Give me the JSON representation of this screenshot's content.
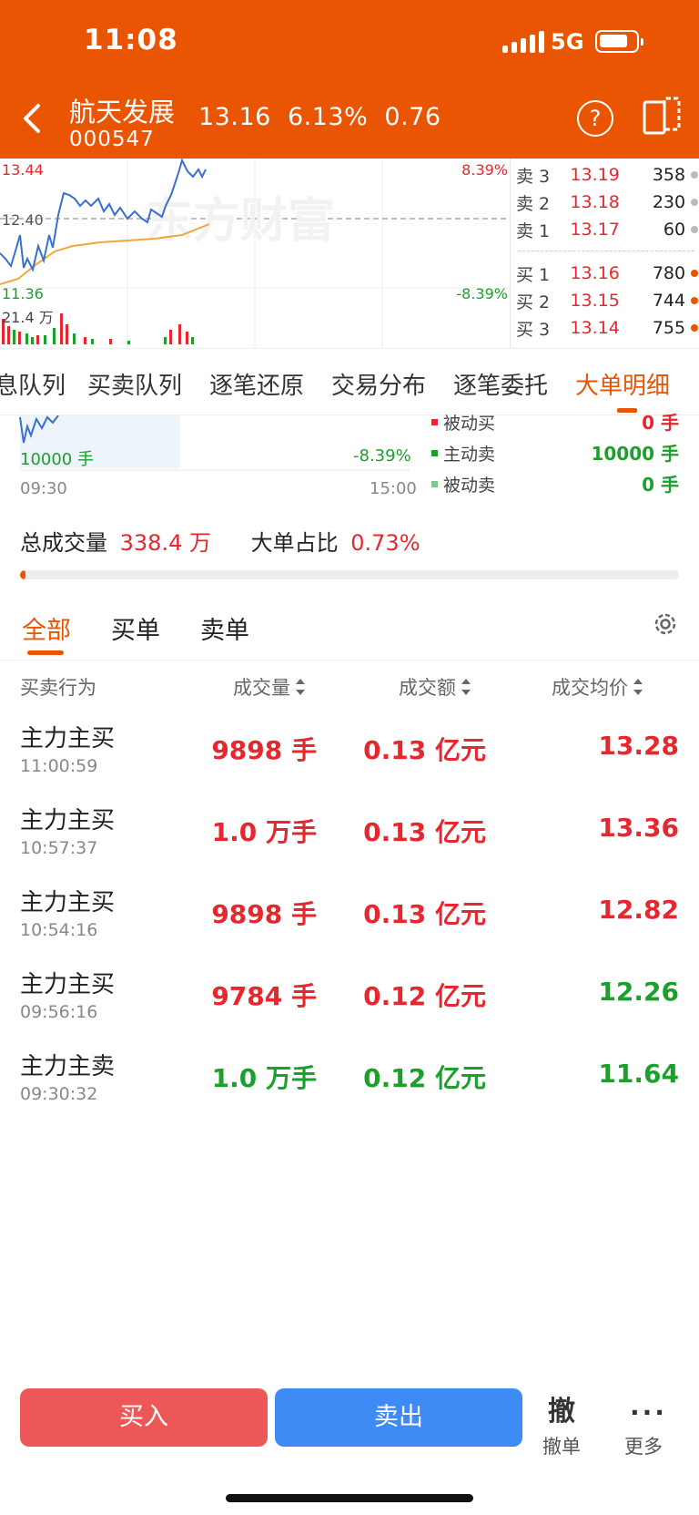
{
  "status": {
    "time": "11:08",
    "network": "5G"
  },
  "header": {
    "name": "航天发展",
    "code": "000547",
    "price": "13.16",
    "change_pct": "6.13%",
    "change": "0.76",
    "help": "?"
  },
  "chart": {
    "high": "13.44",
    "mid": "12.40",
    "low": "11.36",
    "high_pct": "8.39%",
    "low_pct": "-8.39%",
    "volume": "21.4 万",
    "watermark": "东方财富"
  },
  "orderbook": {
    "asks": [
      {
        "label": "卖 3",
        "price": "13.19",
        "vol": "358",
        "color": "#bbbbbb"
      },
      {
        "label": "卖 2",
        "price": "13.18",
        "vol": "230",
        "color": "#bbbbbb"
      },
      {
        "label": "卖 1",
        "price": "13.17",
        "vol": "60",
        "color": "#bbbbbb"
      }
    ],
    "bids": [
      {
        "label": "买 1",
        "price": "13.16",
        "vol": "780",
        "color": "#ea5504"
      },
      {
        "label": "买 2",
        "price": "13.15",
        "vol": "744",
        "color": "#ea5504"
      },
      {
        "label": "买 3",
        "price": "13.14",
        "vol": "755",
        "color": "#ea5504"
      }
    ]
  },
  "tabs": [
    "息队列",
    "买卖队列",
    "逐笔还原",
    "交易分布",
    "逐笔委托",
    "大单明细"
  ],
  "mini_chart": {
    "vol_label": "10000 手",
    "pct": "-8.39%",
    "start": "09:30",
    "end": "15:00",
    "legend": [
      {
        "label": "被动买",
        "value": "0 手",
        "color": "#e8262e"
      },
      {
        "label": "主动卖",
        "value": "10000 手",
        "color": "#1aa12b"
      },
      {
        "label": "被动卖",
        "value": "0 手",
        "color": "#7cc98a"
      }
    ]
  },
  "summary": {
    "total_label": "总成交量",
    "total_value": "338.4 万",
    "ratio_label": "大单占比",
    "ratio_value": "0.73%",
    "ratio_fraction": 0.0073
  },
  "filter_tabs": [
    "全部",
    "买单",
    "卖单"
  ],
  "table": {
    "headers": [
      "买卖行为",
      "成交量",
      "成交额",
      "成交均价"
    ],
    "rows": [
      {
        "action": "主力主买",
        "time": "11:00:59",
        "vol": "9898 手",
        "amount": "0.13 亿元",
        "avg": "13.28",
        "vol_color": "red",
        "amount_color": "red",
        "avg_color": "red"
      },
      {
        "action": "主力主买",
        "time": "10:57:37",
        "vol": "1.0 万手",
        "amount": "0.13 亿元",
        "avg": "13.36",
        "vol_color": "red",
        "amount_color": "red",
        "avg_color": "red"
      },
      {
        "action": "主力主买",
        "time": "10:54:16",
        "vol": "9898 手",
        "amount": "0.13 亿元",
        "avg": "12.82",
        "vol_color": "red",
        "amount_color": "red",
        "avg_color": "red"
      },
      {
        "action": "主力主买",
        "time": "09:56:16",
        "vol": "9784 手",
        "amount": "0.12 亿元",
        "avg": "12.26",
        "vol_color": "red",
        "amount_color": "red",
        "avg_color": "green"
      },
      {
        "action": "主力主卖",
        "time": "09:30:32",
        "vol": "1.0 万手",
        "amount": "0.12 亿元",
        "avg": "11.64",
        "vol_color": "green",
        "amount_color": "green",
        "avg_color": "green"
      }
    ]
  },
  "bottom": {
    "buy": "买入",
    "sell": "卖出",
    "cancel_glyph": "撤",
    "cancel": "撤单",
    "more_glyph": "···",
    "more": "更多"
  }
}
